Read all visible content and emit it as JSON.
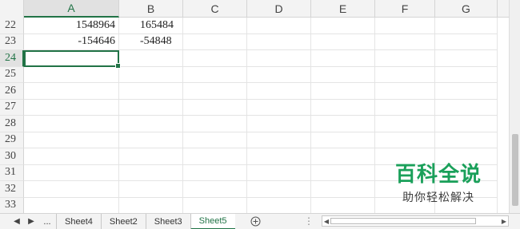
{
  "columns": [
    "A",
    "B",
    "C",
    "D",
    "E",
    "F",
    "G"
  ],
  "selected_column": "A",
  "rows": [
    {
      "num": "22",
      "cells": [
        "1548964",
        "165484",
        "",
        "",
        "",
        "",
        ""
      ]
    },
    {
      "num": "23",
      "cells": [
        "-154646",
        "-54848",
        "",
        "",
        "",
        "",
        ""
      ]
    },
    {
      "num": "24",
      "cells": [
        "",
        "",
        "",
        "",
        "",
        "",
        ""
      ]
    },
    {
      "num": "25",
      "cells": [
        "",
        "",
        "",
        "",
        "",
        "",
        ""
      ]
    },
    {
      "num": "26",
      "cells": [
        "",
        "",
        "",
        "",
        "",
        "",
        ""
      ]
    },
    {
      "num": "27",
      "cells": [
        "",
        "",
        "",
        "",
        "",
        "",
        ""
      ]
    },
    {
      "num": "28",
      "cells": [
        "",
        "",
        "",
        "",
        "",
        "",
        ""
      ]
    },
    {
      "num": "29",
      "cells": [
        "",
        "",
        "",
        "",
        "",
        "",
        ""
      ]
    },
    {
      "num": "30",
      "cells": [
        "",
        "",
        "",
        "",
        "",
        "",
        ""
      ]
    },
    {
      "num": "31",
      "cells": [
        "",
        "",
        "",
        "",
        "",
        "",
        ""
      ]
    },
    {
      "num": "32",
      "cells": [
        "",
        "",
        "",
        "",
        "",
        "",
        ""
      ]
    },
    {
      "num": "33",
      "cells": [
        "",
        "",
        "",
        "",
        "",
        "",
        ""
      ]
    }
  ],
  "active_row": "24",
  "tabbar": {
    "more_label": "...",
    "tabs": [
      "Sheet4",
      "Sheet2",
      "Sheet3",
      "Sheet5"
    ],
    "active_tab": "Sheet5",
    "add_icon": "plus-circle-icon"
  },
  "watermark": {
    "title": "百科全说",
    "subtitle": "助你轻松解决"
  },
  "colors": {
    "accent": "#217346",
    "watermark_green": "#1aa05a"
  }
}
